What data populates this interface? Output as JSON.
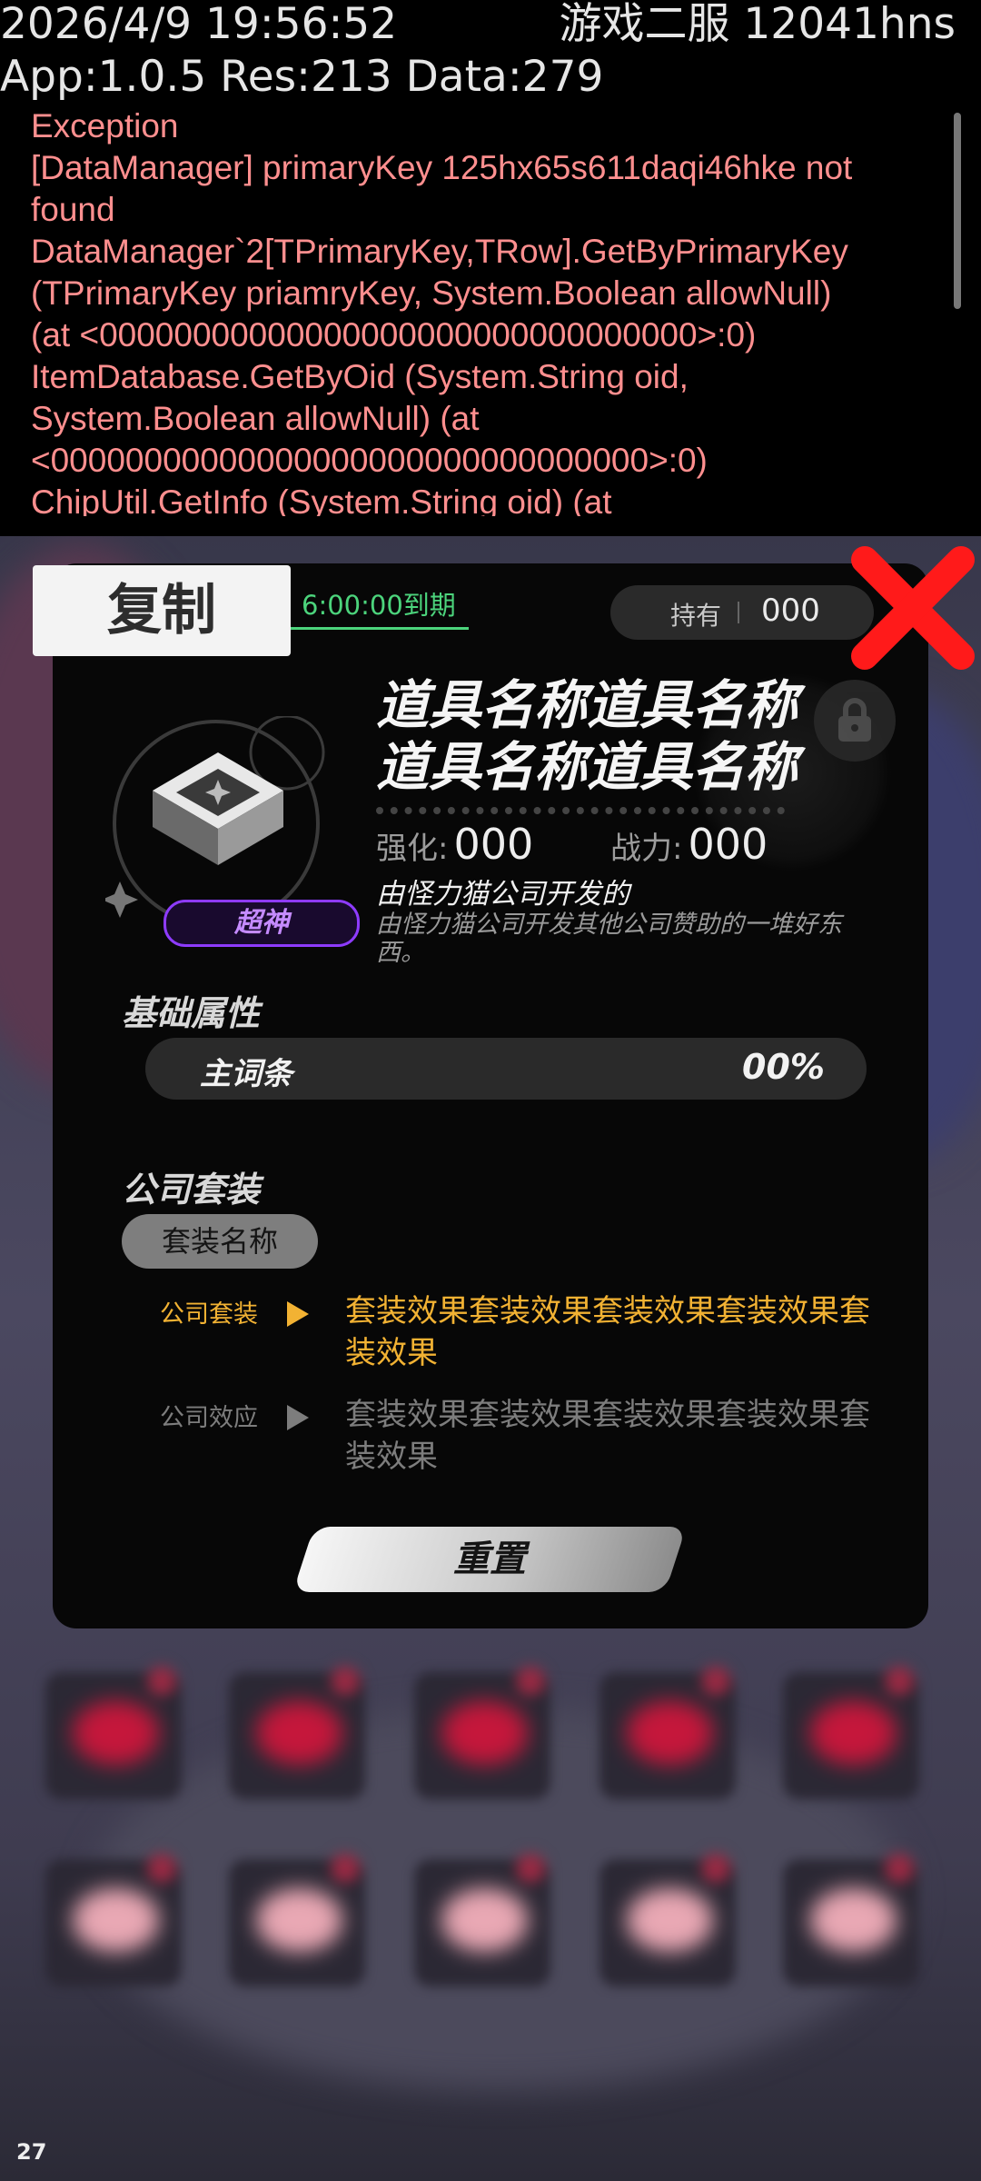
{
  "debug": {
    "datetime": "2026/4/9 19:56:52",
    "server": "游戏二服 12041hns",
    "versions": "App:1.0.5 Res:213 Data:279",
    "log_lines": [
      "Exception",
      "[DataManager] primaryKey 125hx65s611daqi46hke not",
      "found",
      "DataManager`2[TPrimaryKey,TRow].GetByPrimaryKey",
      "(TPrimaryKey priamryKey, System.Boolean allowNull)",
      "(at <00000000000000000000000000000000>:0)",
      "ItemDatabase.GetByOid (System.String oid,",
      "System.Boolean allowNull) (at",
      "<00000000000000000000000000000000>:0)",
      "ChipUtil.GetInfo (System.String oid) (at"
    ]
  },
  "copy_label": "复制",
  "item": {
    "expiry": "6:00:00到期",
    "hold_label": "持有",
    "hold_value": "000",
    "name": "道具名称道具名称道具名称道具名称",
    "tier": "超神",
    "strength_label": "强化:",
    "strength_value": "000",
    "power_label": "战力:",
    "power_value": "000",
    "developer": "由怪力猫公司开发的",
    "description": "由怪力猫公司开发其他公司赞助的一堆好东西。"
  },
  "base_attr": {
    "title": "基础属性",
    "name": "主词条",
    "value": "00%"
  },
  "set": {
    "title": "公司套装",
    "name": "套装名称",
    "effects": [
      {
        "label": "公司套装",
        "text": "套装效果套装效果套装效果套装效果套装效果",
        "active": true,
        "color": "#f2b233"
      },
      {
        "label": "公司效应",
        "text": "套装效果套装效果套装效果套装效果套装效果",
        "active": false,
        "color": "#7d7d7d"
      }
    ]
  },
  "reset_label": "重置",
  "fps": "27",
  "colors": {
    "accent_green": "#4cd47c",
    "tier_purple": "#8e3bff",
    "close_red": "#ff1a1a",
    "active_effect": "#f2b233"
  }
}
